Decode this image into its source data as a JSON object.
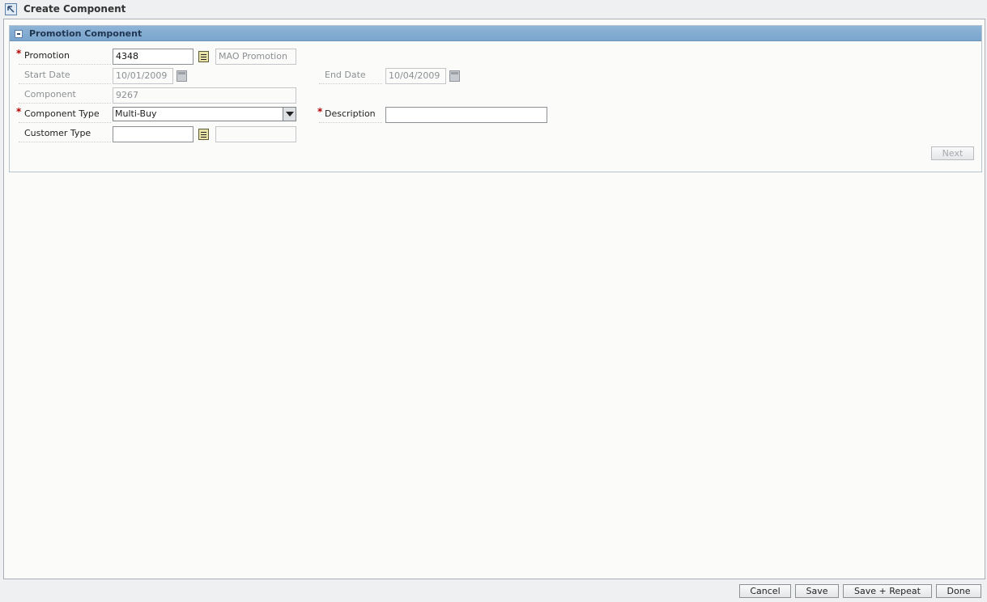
{
  "window": {
    "title": "Create Component"
  },
  "panel": {
    "title": "Promotion Component"
  },
  "form": {
    "promotion": {
      "label": "Promotion",
      "value": "4348",
      "description": "MAO Promotion"
    },
    "start_date": {
      "label": "Start Date",
      "value": "10/01/2009"
    },
    "end_date": {
      "label": "End Date",
      "value": "10/04/2009"
    },
    "component": {
      "label": "Component",
      "value": "9267"
    },
    "component_type": {
      "label": "Component Type",
      "value": "Multi-Buy"
    },
    "description": {
      "label": "Description",
      "value": ""
    },
    "customer_type": {
      "label": "Customer Type",
      "value": "",
      "description": ""
    },
    "required_marker": "*"
  },
  "buttons": {
    "next": "Next",
    "cancel": "Cancel",
    "save": "Save",
    "save_repeat": "Save + Repeat",
    "done": "Done"
  },
  "icons": {
    "title": "component-arrow-icon",
    "collapse": "collapse-minus-icon",
    "lov": "list-of-values-icon",
    "calendar": "calendar-icon",
    "dropdown": "dropdown-arrow-icon"
  }
}
